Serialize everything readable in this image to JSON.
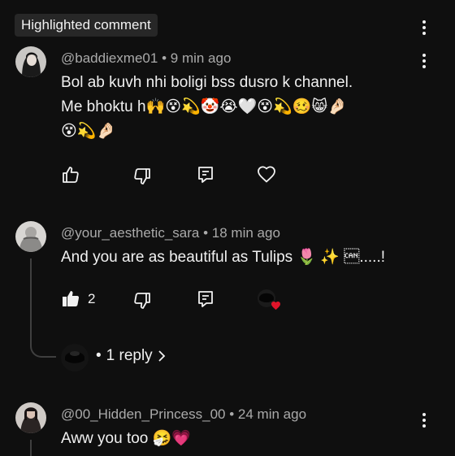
{
  "highlight_label": "Highlighted comment",
  "comments": [
    {
      "author": "@baddiexme01",
      "time": "9 min ago",
      "lines": [
        "Bol ab kuvh nhi boligi bss dusro k channel.",
        "Me bhoktu h🙌😵💫🤡😭🤍😵💫🥴😸🤌🏻",
        "😵💫🤌🏻"
      ]
    },
    {
      "author": "@your_aesthetic_sara",
      "time": "18 min ago",
      "lines": [
        "And you are as beautiful as Tulips 🌷 ✨ \u0018.....!"
      ],
      "like_count": "2",
      "replies_label": "1 reply"
    },
    {
      "author": "@00_Hidden_Princess_00",
      "time": "24 min ago",
      "lines": [
        "Aww you too 🤧💗"
      ]
    }
  ],
  "separator": "•",
  "icons": {
    "more": "kebab-menu-icon",
    "like": "thumbs-up-icon",
    "dislike": "thumbs-down-icon",
    "reply": "reply-comment-icon",
    "heart": "heart-icon",
    "chevron": "chevron-right-icon"
  },
  "colors": {
    "background": "#0f0f0f",
    "chip": "#272727",
    "meta_text": "#aaaaaa",
    "heart": "#e0142a"
  }
}
